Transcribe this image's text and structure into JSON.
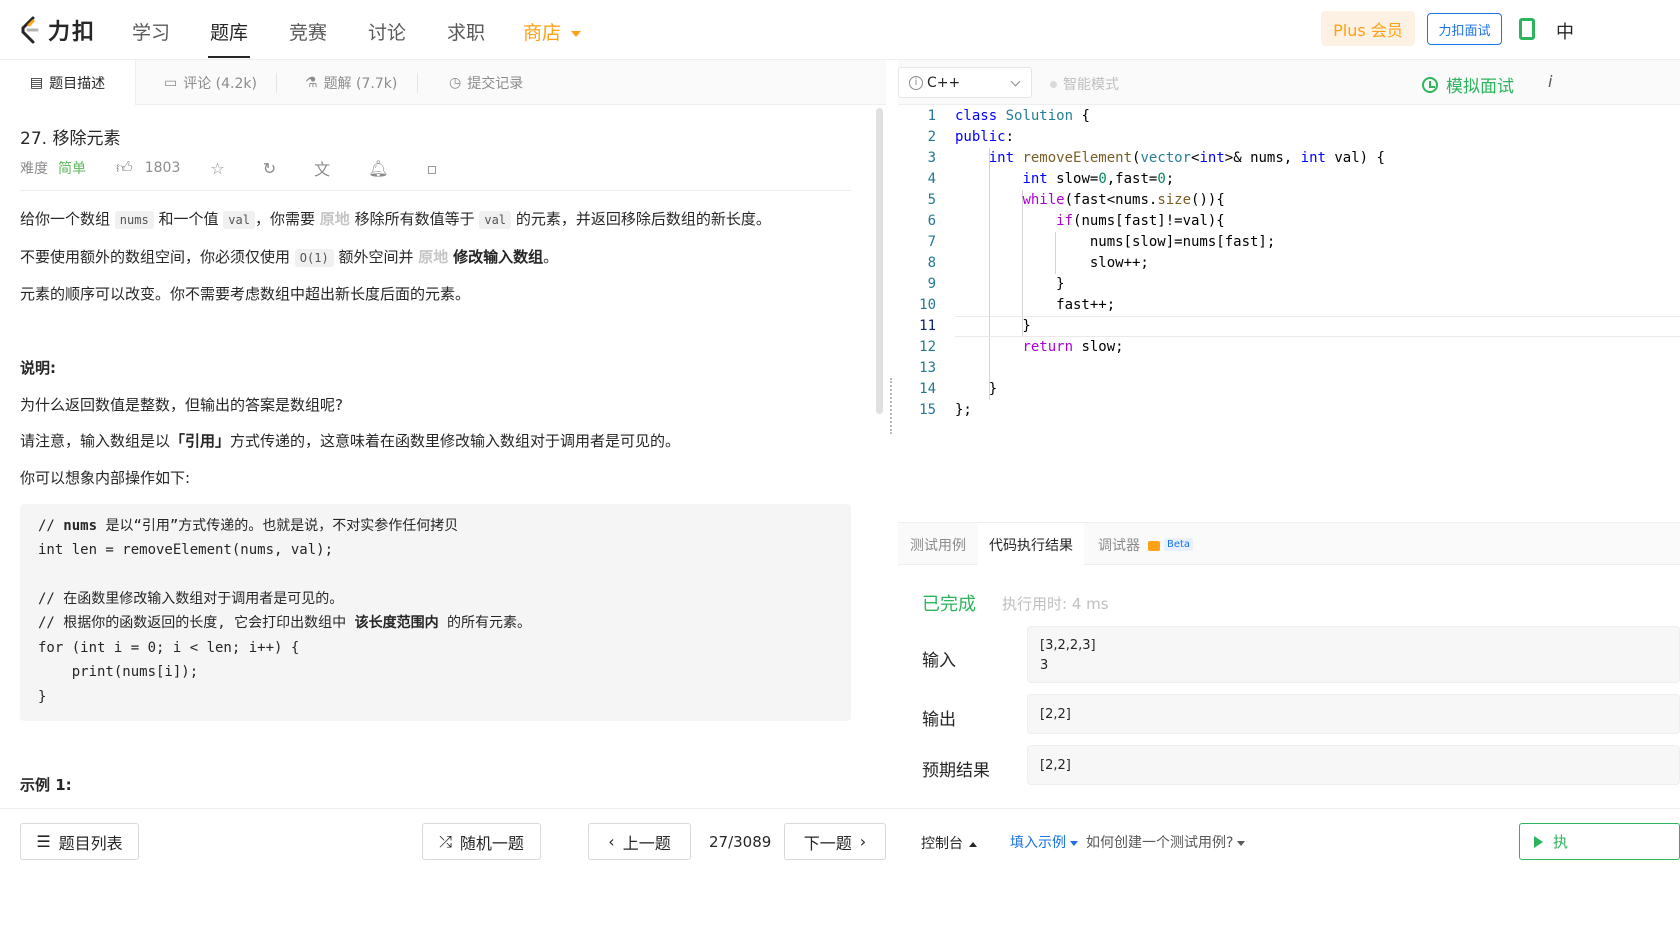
{
  "nav": {
    "logo_text": "力扣",
    "items": [
      "学习",
      "题库",
      "竞赛",
      "讨论",
      "求职"
    ],
    "store": "商店",
    "plus": "Plus 会员",
    "interview": "力扣面试",
    "lang": "中"
  },
  "left_tabs": {
    "desc": "题目描述",
    "comments": "评论 (4.2k)",
    "solutions": "题解 (7.7k)",
    "submissions": "提交记录"
  },
  "problem": {
    "title": "27. 移除元素",
    "difficulty_label": "难度",
    "difficulty": "简单",
    "likes": "1803",
    "p1": {
      "a": "给你一个数组",
      "code1": "nums",
      "b": "和一个值",
      "code2": "val",
      "c": "，你需要",
      "hl": "原地",
      "d": "移除所有数值等于",
      "code3": "val",
      "e": "的元素，并返回移除后数组的新长度。"
    },
    "p2": {
      "a": "不要使用额外的数组空间，你必须仅使用",
      "code": "O(1)",
      "b": "额外空间并",
      "hl": "原地",
      "bold": "修改输入数组",
      "c": "。"
    },
    "p3": "元素的顺序可以改变。你不需要考虑数组中超出新长度后面的元素。",
    "note_title": "说明:",
    "q": "为什么返回数值是整数，但输出的答案是数组呢?",
    "p4": {
      "a": "请注意，输入数组是以",
      "bold": "「引用」",
      "b": "方式传递的，这意味着在函数里修改输入数组对于调用者是可见的。"
    },
    "p5": "你可以想象内部操作如下:",
    "code_lines": [
      {
        "a": "// ",
        "bold": "nums",
        "b": " 是以“引用”方式传递的。也就是说，不对实参作任何拷贝"
      },
      {
        "a": "int len = removeElement(nums, val);",
        "bold": "",
        "b": ""
      },
      {
        "a": "",
        "bold": "",
        "b": ""
      },
      {
        "a": "// 在函数里修改输入数组对于调用者是可见的。",
        "bold": "",
        "b": ""
      },
      {
        "a": "// 根据你的函数返回的长度, 它会打印出数组中 ",
        "bold": "该长度范围内",
        "b": " 的所有元素。"
      },
      {
        "a": "for (int i = 0; i < len; i++) {",
        "bold": "",
        "b": ""
      },
      {
        "a": "    print(nums[i]);",
        "bold": "",
        "b": ""
      },
      {
        "a": "}",
        "bold": "",
        "b": ""
      }
    ],
    "example": "示例 1:"
  },
  "editor": {
    "language": "C++",
    "smart_mode": "智能模式",
    "mock_interview": "模拟面试",
    "info": "i",
    "line_numbers": [
      "1",
      "2",
      "3",
      "4",
      "5",
      "6",
      "7",
      "8",
      "9",
      "10",
      "11",
      "12",
      "13",
      "14",
      "15"
    ]
  },
  "results": {
    "tabs": [
      "测试用例",
      "代码执行结果",
      "调试器"
    ],
    "beta": "Beta",
    "status": "已完成",
    "exec_time": "执行用时: 4 ms",
    "input_label": "输入",
    "input_value": "[3,2,2,3]\n3",
    "output_label": "输出",
    "output_value": "[2,2]",
    "expected_label": "预期结果",
    "expected_value": "[2,2]"
  },
  "bottom": {
    "problem_list": "题目列表",
    "random": "随机一题",
    "prev": "上一题",
    "page": "27/3089",
    "next": "下一题",
    "console": "控制台",
    "fill_example": "填入示例",
    "howto": "如何创建一个测试用例?",
    "run": "执"
  }
}
